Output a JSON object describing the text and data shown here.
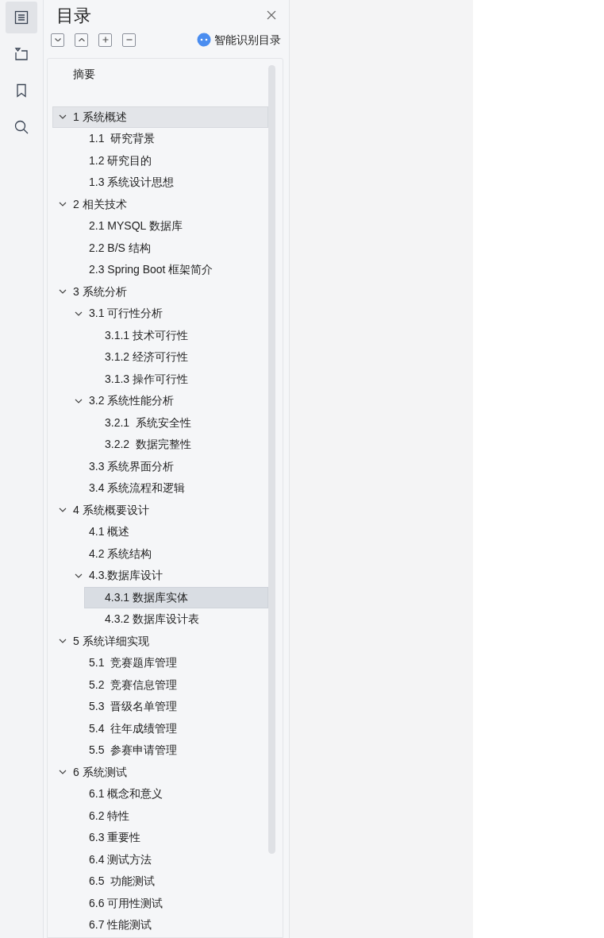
{
  "rail": [
    {
      "kind": "contents",
      "selected": true
    },
    {
      "kind": "outline",
      "selected": false
    },
    {
      "kind": "bookmarks",
      "selected": false
    },
    {
      "kind": "search",
      "selected": false
    }
  ],
  "panel": {
    "title": "目录",
    "smart_button": "智能识别目录"
  },
  "toolbar": [
    {
      "kind": "down"
    },
    {
      "kind": "up"
    },
    {
      "kind": "plus"
    },
    {
      "kind": "minus"
    }
  ],
  "toc": [
    {
      "label": "摘要",
      "selected": false
    },
    {
      "label": "1 系统概述",
      "selected": true,
      "expanded": true,
      "children": [
        {
          "label": "1.1  研究背景",
          "selected": false
        },
        {
          "label": "1.2 研究目的",
          "selected": false
        },
        {
          "label": "1.3 系统设计思想",
          "selected": false
        }
      ]
    },
    {
      "label": "2 相关技术",
      "selected": false,
      "expanded": true,
      "children": [
        {
          "label": "2.1 MYSQL 数据库",
          "selected": false
        },
        {
          "label": "2.2 B/S 结构",
          "selected": false
        },
        {
          "label": "2.3 Spring Boot 框架简介",
          "selected": false
        }
      ]
    },
    {
      "label": "3 系统分析",
      "selected": false,
      "expanded": true,
      "children": [
        {
          "label": "3.1 可行性分析",
          "selected": false,
          "expanded": true,
          "children": [
            {
              "label": "3.1.1 技术可行性",
              "selected": false
            },
            {
              "label": "3.1.2 经济可行性",
              "selected": false
            },
            {
              "label": "3.1.3 操作可行性",
              "selected": false
            }
          ]
        },
        {
          "label": "3.2 系统性能分析",
          "selected": false,
          "expanded": true,
          "children": [
            {
              "label": "3.2.1  系统安全性",
              "selected": false
            },
            {
              "label": "3.2.2  数据完整性",
              "selected": false
            }
          ]
        },
        {
          "label": "3.3 系统界面分析",
          "selected": false
        },
        {
          "label": "3.4 系统流程和逻辑",
          "selected": false
        }
      ]
    },
    {
      "label": "4 系统概要设计",
      "selected": false,
      "expanded": true,
      "children": [
        {
          "label": "4.1 概述",
          "selected": false
        },
        {
          "label": "4.2 系统结构",
          "selected": false
        },
        {
          "label": "4.3.数据库设计",
          "selected": false,
          "expanded": true,
          "children": [
            {
              "label": "4.3.1 数据库实体",
              "selected": true
            },
            {
              "label": "4.3.2 数据库设计表",
              "selected": false
            }
          ]
        }
      ]
    },
    {
      "label": "5 系统详细实现",
      "selected": false,
      "expanded": true,
      "children": [
        {
          "label": "5.1  竞赛题库管理",
          "selected": false
        },
        {
          "label": "5.2  竞赛信息管理",
          "selected": false
        },
        {
          "label": "5.3  晋级名单管理",
          "selected": false
        },
        {
          "label": "5.4  往年成绩管理",
          "selected": false
        },
        {
          "label": "5.5  参赛申请管理",
          "selected": false
        }
      ]
    },
    {
      "label": "6 系统测试",
      "selected": false,
      "expanded": true,
      "children": [
        {
          "label": "6.1 概念和意义",
          "selected": false
        },
        {
          "label": "6.2 特性",
          "selected": false
        },
        {
          "label": "6.3 重要性",
          "selected": false
        },
        {
          "label": "6.4 测试方法",
          "selected": false
        },
        {
          "label": "6.5  功能测试",
          "selected": false
        },
        {
          "label": "6.6 可用性测试",
          "selected": false
        },
        {
          "label": "6.7 性能测试",
          "selected": false
        }
      ]
    }
  ]
}
